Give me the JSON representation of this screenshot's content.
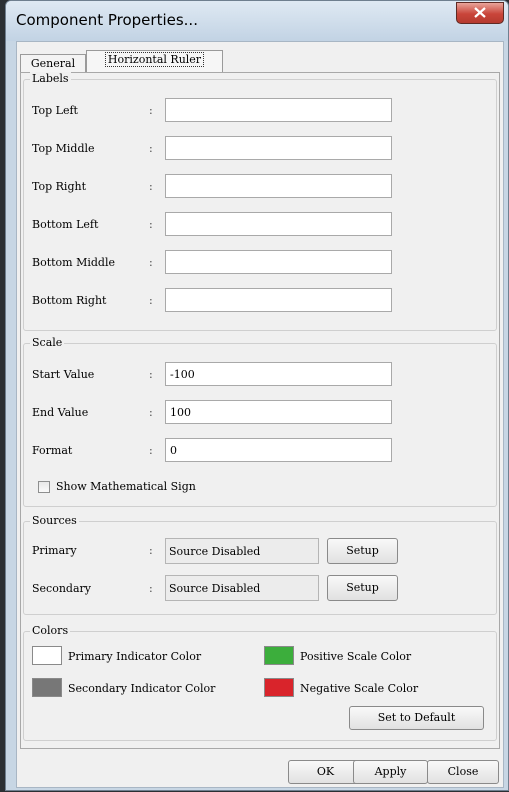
{
  "window": {
    "title": "Component Properties...",
    "close_glyph": "x"
  },
  "tabs": [
    {
      "label": "General"
    },
    {
      "label": "Horizontal Ruler"
    }
  ],
  "labels_group": {
    "title": "Labels",
    "fields": [
      {
        "label": "Top Left",
        "value": ""
      },
      {
        "label": "Top Middle",
        "value": ""
      },
      {
        "label": "Top Right",
        "value": ""
      },
      {
        "label": "Bottom Left",
        "value": ""
      },
      {
        "label": "Bottom Middle",
        "value": ""
      },
      {
        "label": "Bottom Right",
        "value": ""
      }
    ]
  },
  "scale_group": {
    "title": "Scale",
    "fields": [
      {
        "label": "Start Value",
        "value": "-100"
      },
      {
        "label": "End Value",
        "value": "100"
      },
      {
        "label": "Format",
        "value": "0"
      }
    ],
    "show_sign_label": "Show Mathematical Sign",
    "show_sign_checked": false
  },
  "sources_group": {
    "title": "Sources",
    "rows": [
      {
        "label": "Primary",
        "value": "Source Disabled",
        "button": "Setup"
      },
      {
        "label": "Secondary",
        "value": "Source Disabled",
        "button": "Setup"
      }
    ]
  },
  "colors_group": {
    "title": "Colors",
    "items": [
      {
        "label": "Primary Indicator Color",
        "color": "#ffffff"
      },
      {
        "label": "Positive Scale Color",
        "color": "#3cae3c"
      },
      {
        "label": "Secondary Indicator Color",
        "color": "#777777"
      },
      {
        "label": "Negative Scale Color",
        "color": "#d9242b"
      }
    ],
    "default_button": "Set to Default"
  },
  "separator": ":",
  "footer": {
    "ok": "OK",
    "apply": "Apply",
    "close": "Close"
  }
}
